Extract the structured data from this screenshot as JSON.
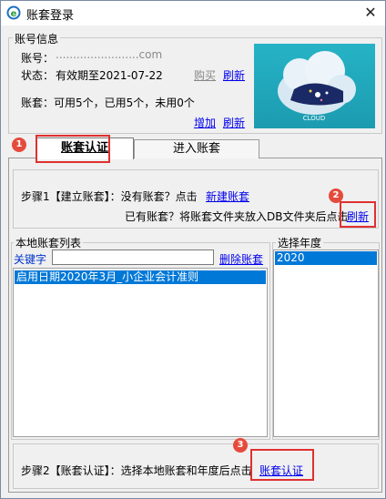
{
  "window": {
    "title": "账套登录",
    "close_glyph": "✕"
  },
  "account_info": {
    "group_label": "账号信息",
    "account_label": "账号：",
    "account_value": "........................com",
    "status_label": "状态：",
    "status_value": "有效期至2021-07-22",
    "buy_label": "购买",
    "refresh_label": "刷新",
    "sets_summary": "账套：可用5个，已用5个，未用0个",
    "add_label": "增加",
    "refresh2_label": "刷新",
    "cloud_text": "CLOUD"
  },
  "tabs": [
    {
      "label": "账套认证"
    },
    {
      "label": "进入账套"
    }
  ],
  "step1": {
    "prefix": "步骤1【建立账套】：没有账套？点击",
    "new_link": "新建账套",
    "line2": "已有账套？将账套文件夹放入DB文件夹后点击",
    "refresh_link": "刷新"
  },
  "local_list": {
    "group_label": "本地账套列表",
    "keyword_label": "关键字",
    "keyword_value": "",
    "delete_link": "删除账套",
    "items": [
      "启用日期2020年3月_小企业会计准则"
    ]
  },
  "year_select": {
    "group_label": "选择年度",
    "items": [
      "2020"
    ]
  },
  "step2": {
    "text": "步骤2【账套认证】：选择本地账套和年度后点击",
    "verify_link": "账套认证"
  },
  "badges": [
    "1",
    "2",
    "3"
  ],
  "colors": {
    "highlight": "#e03030",
    "selection": "#0078d7",
    "link": "#0000ee"
  }
}
